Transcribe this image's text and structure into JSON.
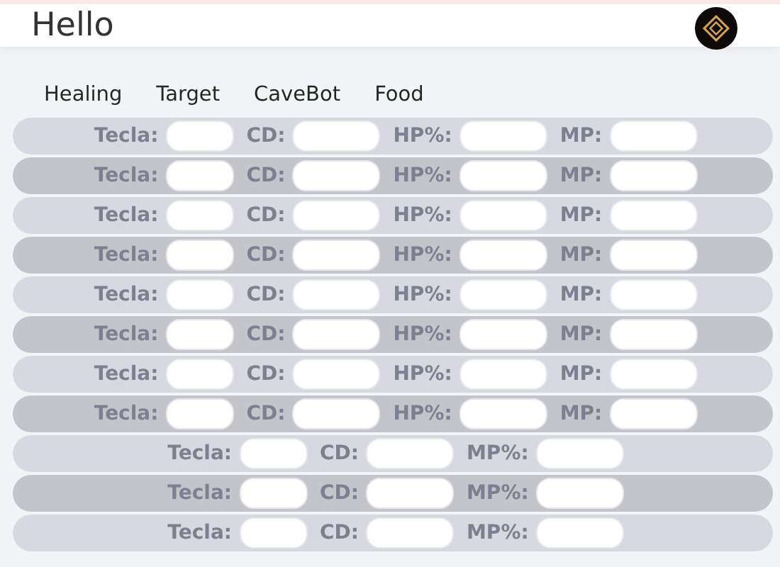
{
  "header": {
    "title": "Hello"
  },
  "tabs": [
    {
      "label": "Healing"
    },
    {
      "label": "Target"
    },
    {
      "label": "CaveBot"
    },
    {
      "label": "Food"
    }
  ],
  "rows": [
    {
      "fields": [
        "Tecla:",
        "CD:",
        "HP%:",
        "MP:"
      ]
    },
    {
      "fields": [
        "Tecla:",
        "CD:",
        "HP%:",
        "MP:"
      ]
    },
    {
      "fields": [
        "Tecla:",
        "CD:",
        "HP%:",
        "MP:"
      ]
    },
    {
      "fields": [
        "Tecla:",
        "CD:",
        "HP%:",
        "MP:"
      ]
    },
    {
      "fields": [
        "Tecla:",
        "CD:",
        "HP%:",
        "MP:"
      ]
    },
    {
      "fields": [
        "Tecla:",
        "CD:",
        "HP%:",
        "MP:"
      ]
    },
    {
      "fields": [
        "Tecla:",
        "CD:",
        "HP%:",
        "MP:"
      ]
    },
    {
      "fields": [
        "Tecla:",
        "CD:",
        "HP%:",
        "MP:"
      ]
    },
    {
      "fields": [
        "Tecla:",
        "CD:",
        "MP%:"
      ]
    },
    {
      "fields": [
        "Tecla:",
        "CD:",
        "MP%:"
      ]
    },
    {
      "fields": [
        "Tecla:",
        "CD:",
        "MP%:"
      ]
    }
  ]
}
